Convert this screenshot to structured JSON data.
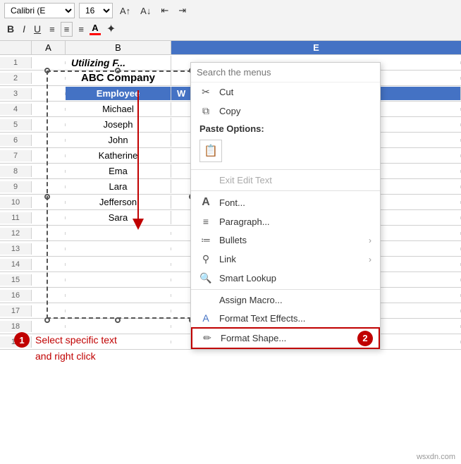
{
  "ribbon": {
    "font_name": "Calibri (E",
    "font_size": "16",
    "bold": "B",
    "italic": "I",
    "underline": "U",
    "align_left": "≡",
    "align_center": "≡",
    "align_right": "≡",
    "font_color": "A",
    "highlight": "✦"
  },
  "columns": {
    "a": "A",
    "b": "B",
    "e": "E"
  },
  "title_row": {
    "text": "Utilizing F..."
  },
  "company_row": {
    "text": "ABC Company"
  },
  "header_row": {
    "employee": "Employee",
    "wage": "W"
  },
  "employees": [
    "Michael",
    "Joseph",
    "John",
    "Katherine",
    "Ema",
    "Lara",
    "Jefferson",
    "Sara"
  ],
  "row_numbers": [
    "1",
    "2",
    "3",
    "4",
    "5",
    "6",
    "7",
    "8",
    "9",
    "10",
    "11",
    "12",
    "13",
    "14",
    "15",
    "16",
    "17",
    "18",
    "19"
  ],
  "context_menu": {
    "search_placeholder": "Search the menus",
    "items": [
      {
        "id": "cut",
        "icon": "✂",
        "label": "Cuᵗ",
        "has_arrow": false,
        "disabled": false
      },
      {
        "id": "copy",
        "icon": "⧉",
        "label": "Copy",
        "has_arrow": false,
        "disabled": false
      },
      {
        "id": "paste-options-label",
        "label": "Paste Options:",
        "bold": true
      },
      {
        "id": "paste-icon",
        "icon": "📋"
      },
      {
        "id": "exit-edit",
        "label": "Exit Edit Text",
        "disabled": true
      },
      {
        "id": "font",
        "icon": "A",
        "label": "Font...",
        "has_arrow": false,
        "disabled": false
      },
      {
        "id": "paragraph",
        "icon": "≡",
        "label": "Paragraph...",
        "has_arrow": false,
        "disabled": false
      },
      {
        "id": "bullets",
        "icon": "≔",
        "label": "Bullets",
        "has_arrow": true,
        "disabled": false
      },
      {
        "id": "link",
        "icon": "⚲",
        "label": "Link",
        "has_arrow": true,
        "disabled": false
      },
      {
        "id": "smart-lookup",
        "icon": "🔍",
        "label": "Smart Lookup",
        "has_arrow": false,
        "disabled": false
      },
      {
        "id": "assign-macro",
        "label": "Assign Macro...",
        "has_arrow": false,
        "disabled": false
      },
      {
        "id": "format-text-effects",
        "icon": "A",
        "label": "Format Text Effects...",
        "has_arrow": false,
        "disabled": false
      },
      {
        "id": "format-shape",
        "icon": "✏",
        "label": "Format Shape...",
        "has_arrow": false,
        "disabled": false,
        "highlighted": true
      }
    ]
  },
  "annotations": {
    "step1_circle": "1",
    "step1_text": "Select specific text",
    "step1_text2": "and right click",
    "step2_circle": "2"
  },
  "watermark": "wsxdn.com"
}
